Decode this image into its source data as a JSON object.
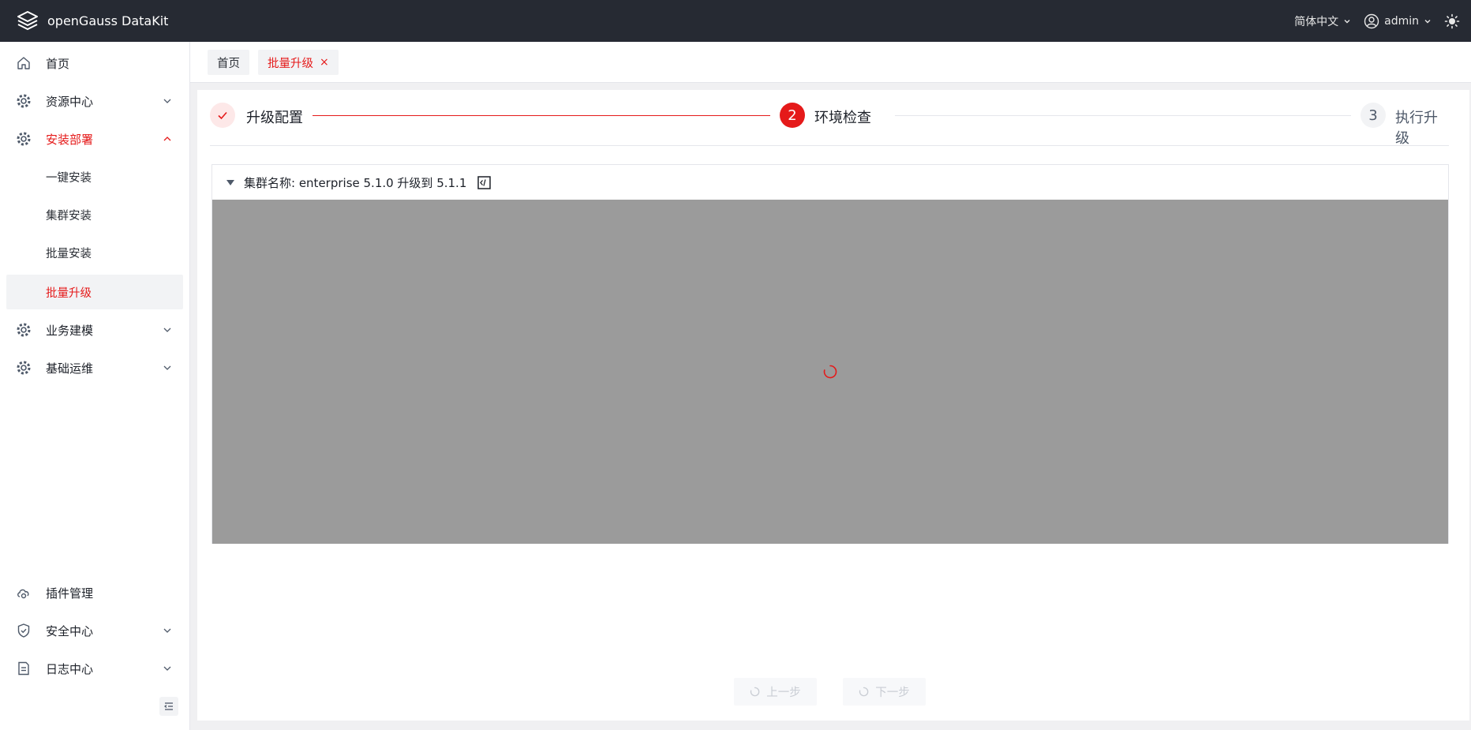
{
  "header": {
    "app_title": "openGauss DataKit",
    "language": "简体中文",
    "user": "admin",
    "icons": {
      "logo": "layers-logo-icon",
      "user": "user-circle-icon",
      "theme": "sun-icon"
    }
  },
  "sidebar": {
    "items": [
      {
        "label": "首页",
        "icon": "home-icon"
      },
      {
        "label": "资源中心",
        "icon": "gear-icon"
      },
      {
        "label": "安装部署",
        "icon": "gear-icon"
      },
      {
        "label": "一键安装"
      },
      {
        "label": "集群安装"
      },
      {
        "label": "批量安装"
      },
      {
        "label": "批量升级"
      },
      {
        "label": "业务建模",
        "icon": "gear-icon"
      },
      {
        "label": "基础运维",
        "icon": "gear-icon"
      },
      {
        "label": "插件管理",
        "icon": "plugin-cloud-icon"
      },
      {
        "label": "安全中心",
        "icon": "shield-icon"
      },
      {
        "label": "日志中心",
        "icon": "document-icon"
      }
    ]
  },
  "tabs": {
    "home": "首页",
    "active": "批量升级",
    "close_glyph": "×"
  },
  "steps": [
    {
      "title": "升级配置",
      "status": "finished"
    },
    {
      "number": "2",
      "title": "环境检查",
      "status": "active"
    },
    {
      "number": "3",
      "title": "执行升级",
      "status": "waiting"
    }
  ],
  "cluster_panel": {
    "title": "集群名称: enterprise 5.1.0 升级到 5.1.1",
    "loading": true
  },
  "buttons": {
    "prev": "上一步",
    "next": "下一步"
  },
  "colors": {
    "accent": "#e51a1a",
    "header_bg": "#262a33",
    "loading_mask": "#9b9b9b"
  }
}
